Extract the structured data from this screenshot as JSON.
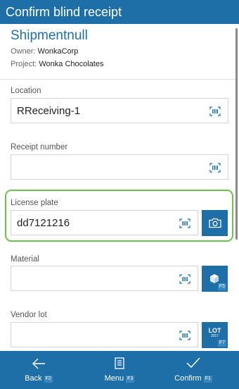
{
  "header": {
    "title": "Confirm blind receipt"
  },
  "shipment": {
    "title": "Shipmentnull",
    "owner_label": "Owner:",
    "owner_value": "WonkaCorp",
    "project_label": "Project:",
    "project_value": "Wonka Chocolates"
  },
  "fields": {
    "location": {
      "label": "Location",
      "value": "RReceiving-1"
    },
    "receipt_number": {
      "label": "Receipt number",
      "value": ""
    },
    "license_plate": {
      "label": "License plate",
      "value": "dd7121216"
    },
    "material": {
      "label": "Material",
      "value": "",
      "button_key": "F5"
    },
    "vendor_lot": {
      "label": "Vendor lot",
      "value": "",
      "button_text_top": "LOT",
      "button_text_bottom": "2017",
      "button_key": "F7"
    }
  },
  "footer": {
    "back": {
      "label": "Back",
      "key": "F2"
    },
    "menu": {
      "label": "Menu",
      "key": "F3"
    },
    "confirm": {
      "label": "Confirm",
      "key": "F1"
    }
  },
  "colors": {
    "primary": "#1e6fa8",
    "highlight": "#6cc24a"
  }
}
